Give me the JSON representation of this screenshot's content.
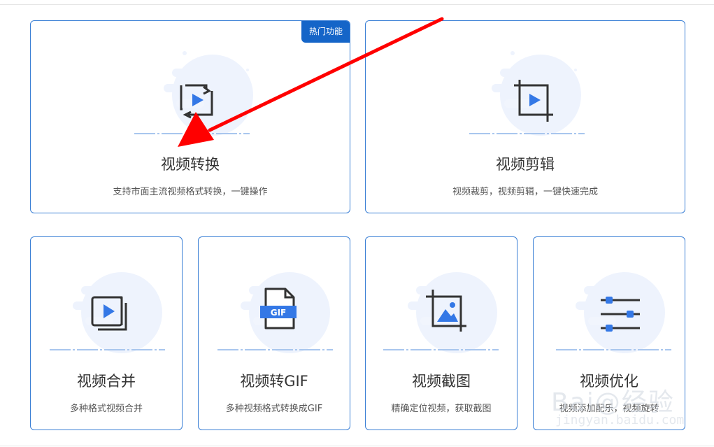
{
  "cards": [
    {
      "title": "视频转换",
      "desc": "支持市面主流视频格式转换，一键操作",
      "badge": "热门功能",
      "icon": "convert-icon"
    },
    {
      "title": "视频剪辑",
      "desc": "视频裁剪，视频剪辑，一键快速完成",
      "icon": "crop-video-icon"
    },
    {
      "title": "视频合并",
      "desc": "多种格式视频合并",
      "icon": "merge-icon"
    },
    {
      "title": "视频转GIF",
      "desc": "多种视频格式转换成GIF",
      "icon": "gif-icon",
      "icon_text": "GIF"
    },
    {
      "title": "视频截图",
      "desc": "精确定位视频，获取截图",
      "icon": "screenshot-icon"
    },
    {
      "title": "视频优化",
      "desc": "视频添加配乐，视频旋转",
      "icon": "sliders-icon"
    }
  ],
  "watermark": {
    "main": "Bai@经验",
    "sub": "jingyan.baidu.com"
  },
  "colors": {
    "accent": "#3a7fd5",
    "badge": "#1565c8",
    "play": "#3478e6",
    "arrow": "#ff0000"
  }
}
